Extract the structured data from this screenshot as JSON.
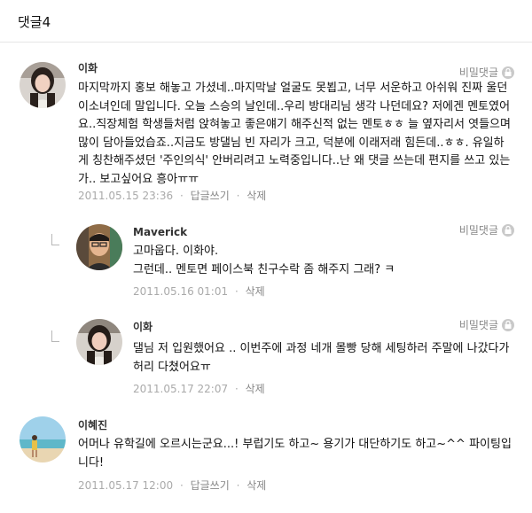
{
  "header": {
    "title": "댓글4"
  },
  "comments": [
    {
      "author": "이화",
      "secret_label": "비밀댓글",
      "text": "마지막까지 홍보 해놓고 가셨네..마지막날 얼굴도 못뵙고, 너무 서운하고 아쉬워 진짜 울던 이소녀인데 말입니다. 오늘 스승의 날인데..우리 방대리님 생각 나던데요? 저에겐 멘토였어요..직장체험 학생들처럼 앉혀놓고 좋은얘기 해주신적 없는 멘토ㅎㅎ 늘 옆자리서 엿들으며 많이 담아들었습죠..지금도 방댈님 빈 자리가 크고, 덕분에 이래저래 힘든데..ㅎㅎ. 유일하게 칭찬해주셨던 '주인의식' 안버리려고 노력중입니다..난 왜 댓글 쓰는데 편지를 쓰고 있는가.. 보고싶어요 흥아ㅠㅠ",
      "date": "2011.05.15 23:36",
      "reply_label": "답글쓰기",
      "delete_label": "삭제"
    },
    {
      "author": "Maverick",
      "secret_label": "비밀댓글",
      "text_lines": [
        "고마웁다. 이화야.",
        "그런데.. 멘토면 페이스북 친구수락 좀 해주지 그래? ㅋ"
      ],
      "date": "2011.05.16 01:01",
      "delete_label": "삭제"
    },
    {
      "author": "이화",
      "secret_label": "비밀댓글",
      "text": "댈님 저 입원했어요 .. 이번주에 과정 네개 몰빵 당해 세팅하러 주말에 나갔다가 허리 다쳤어요ㅠ",
      "date": "2011.05.17 22:07",
      "delete_label": "삭제"
    },
    {
      "author": "이혜진",
      "text": "어머나 유학길에 오르시는군요...! 부럽기도 하고~ 용기가 대단하기도 하고~^^ 파이팅입니다!",
      "date": "2011.05.17 12:00",
      "reply_label": "답글쓰기",
      "delete_label": "삭제"
    }
  ]
}
